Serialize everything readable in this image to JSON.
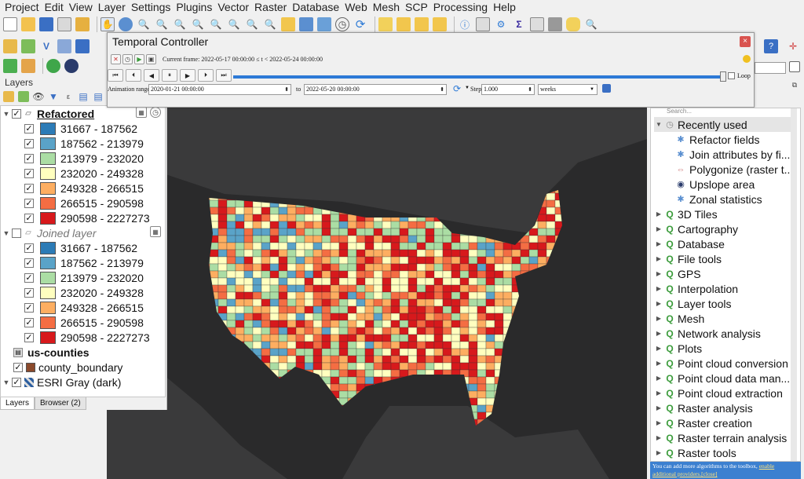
{
  "menubar": [
    "Project",
    "Edit",
    "View",
    "Layer",
    "Settings",
    "Plugins",
    "Vector",
    "Raster",
    "Database",
    "Web",
    "Mesh",
    "SCP",
    "Processing",
    "Help"
  ],
  "colors": {
    "accent": "#2d7ad6",
    "class1": "#2c7bb6",
    "class2": "#5aa3c8",
    "class3": "#abdda4",
    "class4": "#ffffbf",
    "class5": "#fdae61",
    "class6": "#f46d43",
    "class7": "#d7191c"
  },
  "layers_panel": {
    "title": "Layers",
    "refactored": {
      "name": "Refactored",
      "classes": [
        "31667 - 187562",
        "187562 - 213979",
        "213979 - 232020",
        "232020 - 249328",
        "249328 - 266515",
        "266515 - 290598",
        "290598 - 2227273"
      ]
    },
    "joined": {
      "name": "Joined layer",
      "classes": [
        "31667 - 187562",
        "187562 - 213979",
        "213979 - 232020",
        "232020 - 249328",
        "249328 - 266515",
        "266515 - 290598",
        "290598 - 2227273"
      ]
    },
    "us_counties": "us-counties",
    "county_boundary": "county_boundary",
    "basemap": "ESRI Gray (dark)",
    "tabs": [
      "Layers",
      "Browser (2)"
    ]
  },
  "temporal": {
    "title": "Temporal Controller",
    "current_frame": "Current frame: 2022-05-17 00:00:00 ≤ t < 2022-05-24 00:00:00",
    "loop_label": "Loop",
    "range_label": "Animation range",
    "range_start": "2020-01-21 00:00:00",
    "to_label": "to",
    "range_end": "2022-05-20 00:00:00",
    "step_label": "Step",
    "step_value": "1.000",
    "step_unit": "weeks",
    "close": "×"
  },
  "toolbox": {
    "search_placeholder": "Search...",
    "recently_used": "Recently used",
    "recent": [
      "Refactor fields",
      "Join attributes by fi...",
      "Polygonize (raster t...",
      "Upslope area",
      "Zonal statistics"
    ],
    "groups": [
      "3D Tiles",
      "Cartography",
      "Database",
      "File tools",
      "GPS",
      "Interpolation",
      "Layer tools",
      "Mesh",
      "Network analysis",
      "Plots",
      "Point cloud conversion",
      "Point cloud data man...",
      "Point cloud extraction",
      "Raster analysis",
      "Raster creation",
      "Raster terrain analysis",
      "Raster tools"
    ],
    "footer_text": "You can add more algorithms to the toolbox,",
    "footer_link1": "enable",
    "footer_link2": "additional providers.",
    "footer_close": "[close]"
  }
}
